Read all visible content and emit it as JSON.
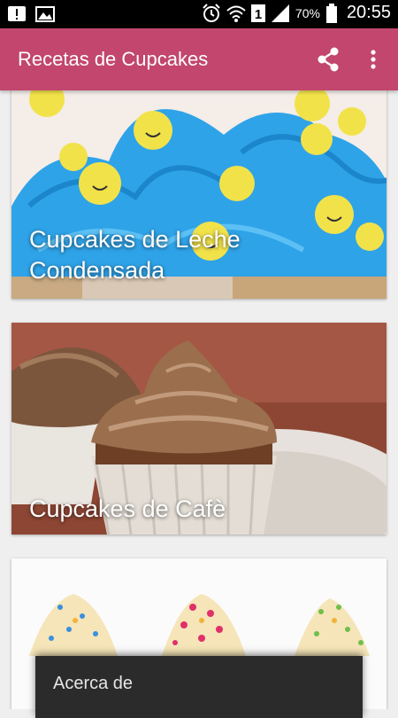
{
  "status_bar": {
    "battery_percent": "70%",
    "sim_slot": "1",
    "time": "20:55",
    "icons": [
      "notification-icon",
      "image-icon",
      "alarm-icon",
      "wifi-icon",
      "sim-icon",
      "signal-icon",
      "battery-icon"
    ]
  },
  "app_bar": {
    "title": "Recetas de Cupcakes",
    "background": "#c2466d",
    "actions": [
      "share-icon",
      "more-vert-icon"
    ]
  },
  "recipes": [
    {
      "title": "Cupcakes de Leche\nCondensada",
      "image": "blue-frosted-cupcakes-smiley"
    },
    {
      "title": "Cupcakes de Cafè",
      "image": "coffee-cupcake"
    },
    {
      "title": "",
      "image": "sprinkle-cupcakes"
    }
  ],
  "popup_menu": {
    "items": [
      "Acerca de"
    ]
  }
}
